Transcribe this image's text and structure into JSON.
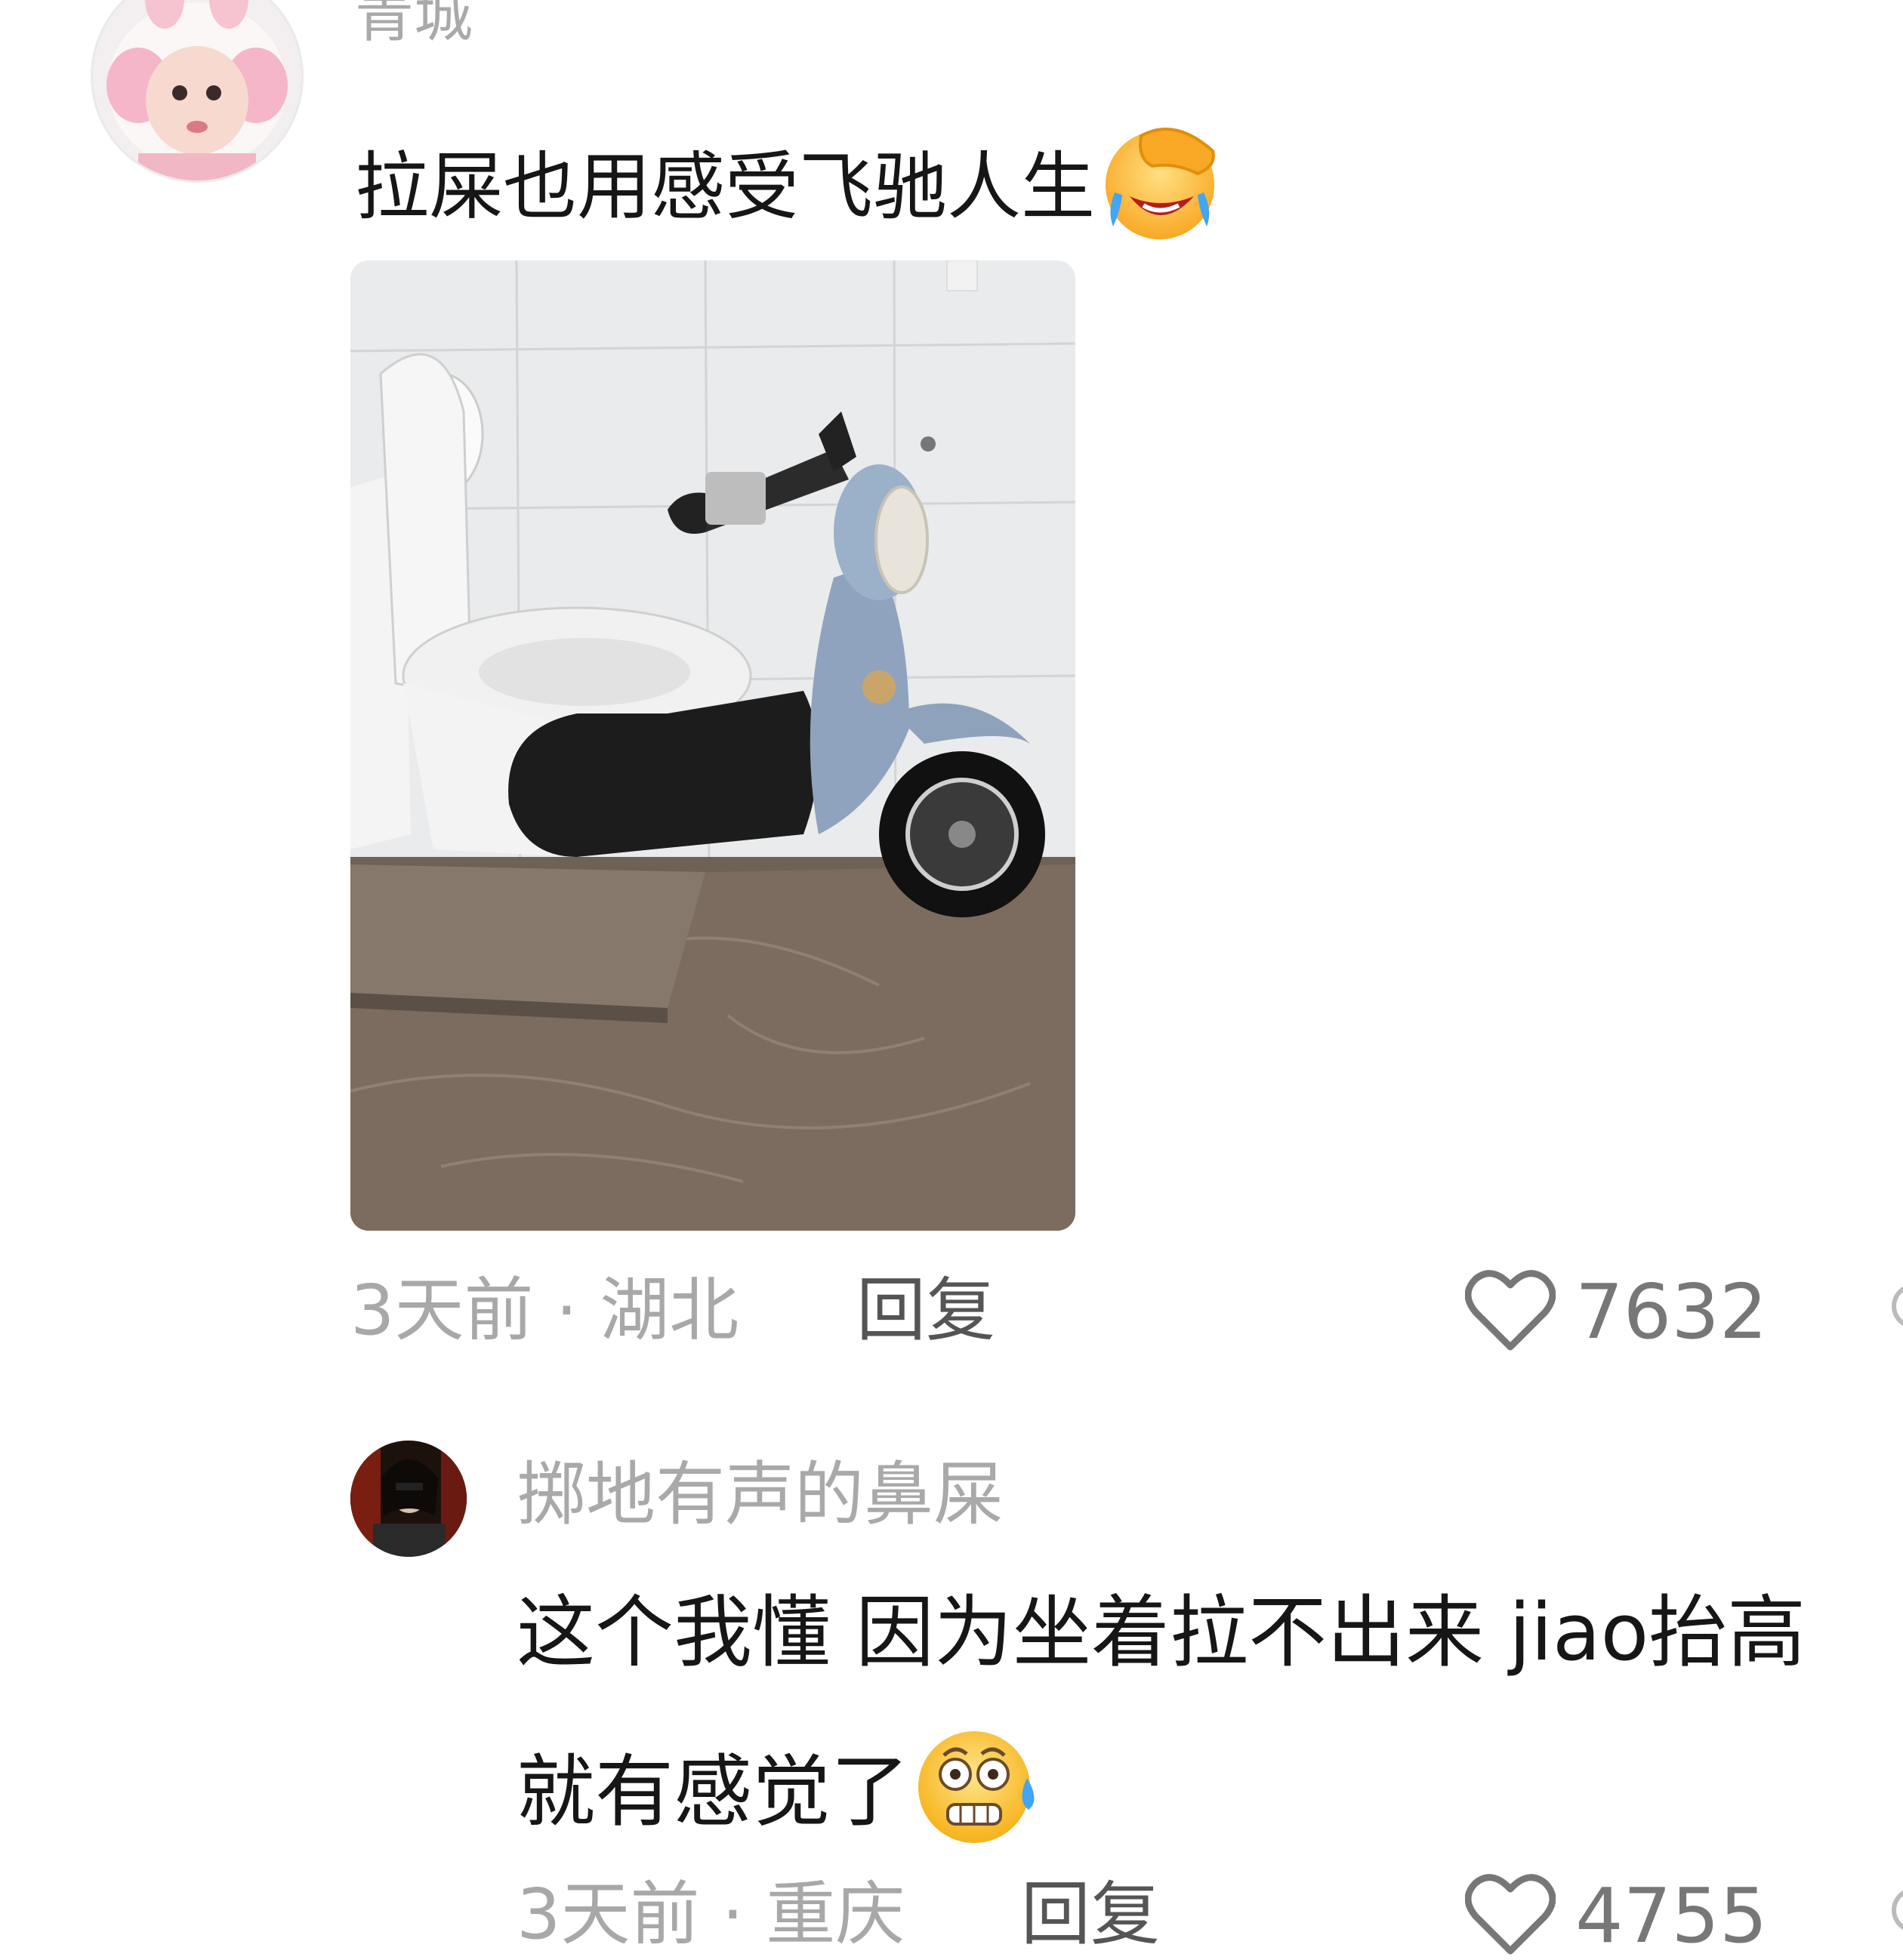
{
  "comments": [
    {
      "username": "青城",
      "text": "拉屎也用感受飞驰人生",
      "emoji": "laughing-tears-facepalm-emoji",
      "time": "3天前",
      "location": "湖北",
      "meta_separator": " · ",
      "reply_label": "回复",
      "likes": "7632"
    },
    {
      "username": "掷地有声的鼻屎",
      "text_line1": "这个我懂 因为坐着拉不出来 jiao抬高",
      "text_line2": "就有感觉了",
      "emoji": "nervous-sweat-emoji",
      "time": "3天前",
      "location": "重庆",
      "meta_separator": " · ",
      "reply_label": "回复",
      "likes": "4755"
    }
  ],
  "colors": {
    "username": "#a9a9a9",
    "text": "#161616",
    "meta": "#a8a8a8",
    "reply": "#555555",
    "like_icon": "#777777"
  }
}
